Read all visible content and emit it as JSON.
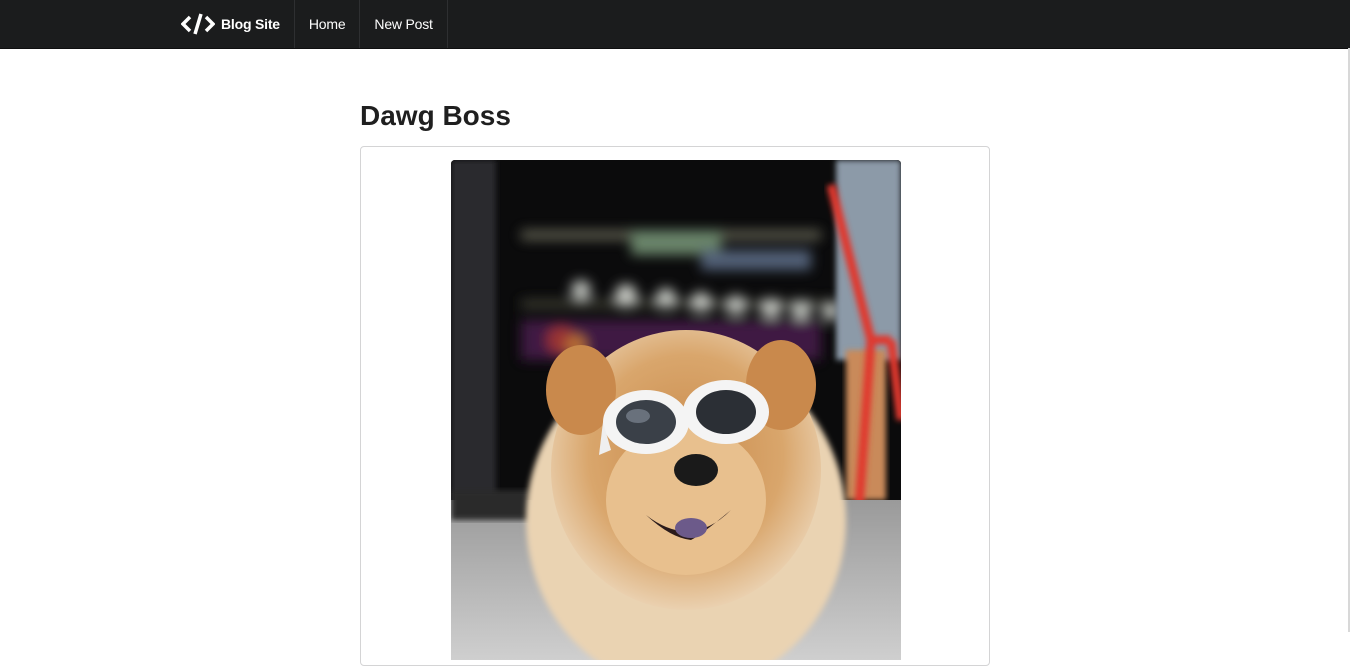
{
  "navbar": {
    "brand_icon": "code-icon",
    "brand_label": "Blog Site",
    "items": [
      {
        "label": "Home"
      },
      {
        "label": "New Post"
      }
    ],
    "background": "#1b1c1d"
  },
  "post": {
    "title": "Dawg Boss",
    "image_icon": "dog-photo"
  }
}
